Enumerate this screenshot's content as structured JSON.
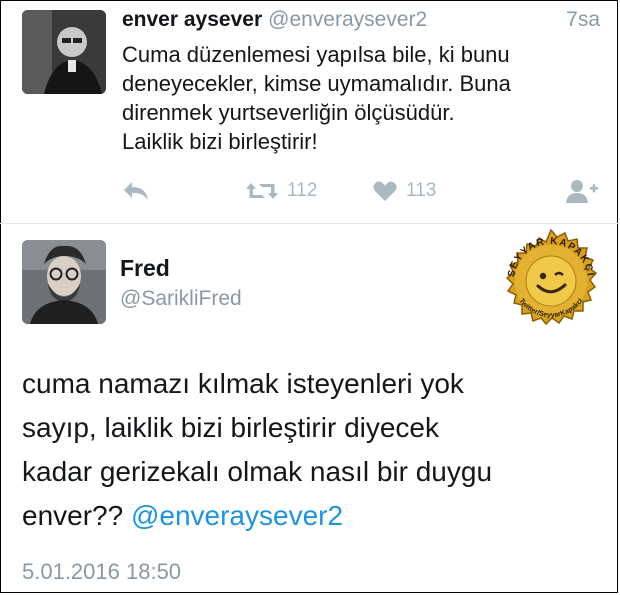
{
  "tweet1": {
    "display_name": "enver aysever",
    "handle": "@enveraysever2",
    "time": "7sa",
    "text_lines": [
      "Cuma düzenlemesi yapılsa bile, ki bunu",
      "deneyecekler, kimse uymamalıdır. Buna",
      "direnmek yurtseverliğin ölçüsüdür.",
      "Laiklik bizi birleştirir!"
    ],
    "actions": {
      "reply_icon": "reply-icon",
      "retweet_icon": "retweet-icon",
      "retweet_count": "112",
      "like_icon": "heart-icon",
      "like_count": "113",
      "follow_icon": "follow-user-icon"
    }
  },
  "tweet2": {
    "display_name": "Fred",
    "handle": "@SarikliFred",
    "text_lines": [
      "cuma namazı kılmak isteyenleri yok",
      "sayıp, laiklik bizi birleştirir diyecek",
      "kadar gerizekalı olmak nasıl bir duygu"
    ],
    "text_last_line_prefix": "enver??",
    "mention": "@enveraysever2",
    "date": "5.01.2016 18:50"
  },
  "watermark": {
    "top_text": "SEYYAR KAPAKÇI",
    "bottom_text": "Twitter/SeyyarKapakci"
  },
  "colors": {
    "text": "#14171a",
    "muted": "#8899a6",
    "action": "#aab8c2",
    "link": "#1b95e0",
    "divider": "#e1e8ed",
    "badge_gold": "#d9a21b"
  }
}
